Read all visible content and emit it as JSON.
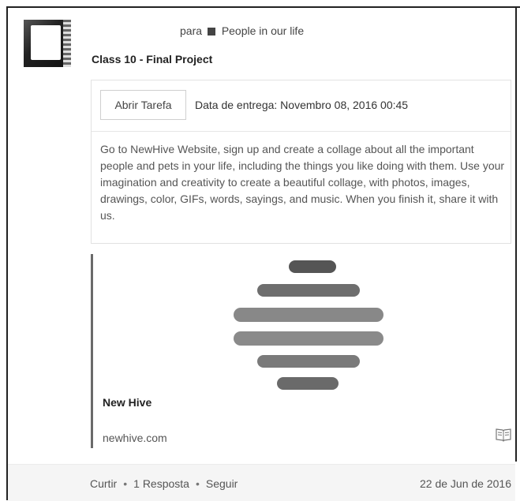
{
  "post": {
    "recipient_prefix": "para",
    "recipient_group": "People in our life",
    "title": "Class 10 - Final Project"
  },
  "task": {
    "open_button_label": "Abrir Tarefa",
    "due_date": "Data de entrega: Novembro 08, 2016 00:45",
    "description": "Go to NewHive Website, sign up and create a collage about all the important people and pets in your life, including the things you like doing with them. Use your imagination and creativity to create a beautiful collage, with photos, images, drawings, color, GIFs, words, sayings, and music. When you finish it, share it with us."
  },
  "link_preview": {
    "title": "New Hive",
    "url": "newhive.com",
    "icon": "book-icon"
  },
  "footer": {
    "like": "Curtir",
    "separator": "•",
    "replies": "1 Resposta",
    "follow": "Seguir",
    "date": "22 de Jun de 2016"
  },
  "colors": {
    "text": "#333333",
    "muted": "#555555",
    "border": "#e2e2e2",
    "footer_bg": "#f5f5f5"
  }
}
